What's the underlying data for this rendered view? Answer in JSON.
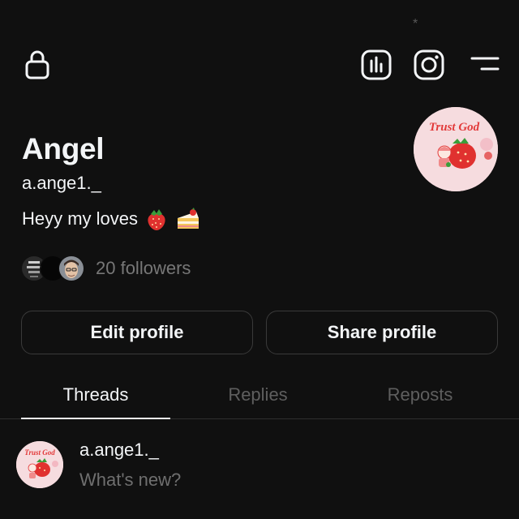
{
  "status": {
    "indicator": "*"
  },
  "header": {
    "icons": [
      "lock-icon",
      "insights-icon",
      "instagram-icon",
      "menu-icon"
    ]
  },
  "profile": {
    "display_name": "Angel",
    "username": "a.ange1._",
    "bio_text": "Heyy my loves",
    "bio_emojis": [
      "strawberry",
      "shortcake"
    ],
    "avatar_text": "Trust God",
    "followers_text": "20 followers"
  },
  "actions": {
    "edit_label": "Edit profile",
    "share_label": "Share profile"
  },
  "tabs": [
    {
      "label": "Threads",
      "active": true
    },
    {
      "label": "Replies",
      "active": false
    },
    {
      "label": "Reposts",
      "active": false
    }
  ],
  "composer": {
    "username": "a.ange1._",
    "placeholder": "What's new?",
    "avatar_text": "Trust God"
  },
  "colors": {
    "background": "#101010",
    "text": "#f3f5f7",
    "muted": "#777777",
    "inactive_tab": "#5e5e5e",
    "border": "#3a3a3a",
    "avatar_bg": "#f6dcdf",
    "avatar_text": "#e23a3a"
  }
}
